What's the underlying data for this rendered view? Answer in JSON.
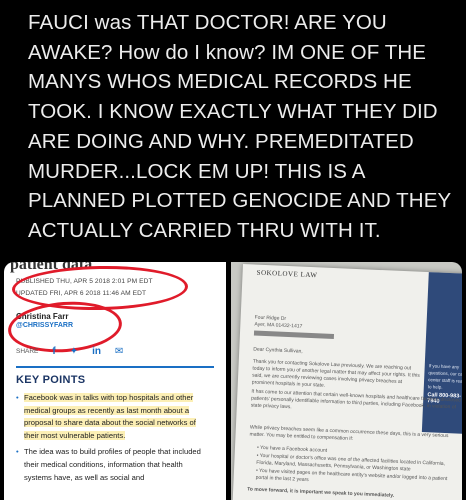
{
  "post": {
    "text": "FAUCI was THAT DOCTOR! ARE YOU AWAKE? How do I know? IM ONE OF THE MANYS WHOS MEDICAL RECORDS HE TOOK. I KNOW EXACTLY WHAT THEY DID ARE DOING AND WHY. PREMEDITATED MURDER...LOCK EM UP! THIS IS A PLANNED PLOTTED GENOCIDE AND THEY ACTUALLY CARRIED THRU WITH IT."
  },
  "article": {
    "heading_fragment": "patient data",
    "published": "PUBLISHED THU, APR 5 2018 2:01 PM EDT",
    "updated": "UPDATED FRI, APR 6 2018 11:46 AM EDT",
    "author": "Christina Farr",
    "handle": "@CHRISSYFARR",
    "share_label": "SHARE",
    "key_points_title": "KEY POINTS",
    "points": [
      "Facebook was in talks with top hospitals and other medical groups as recently as last month about a proposal to share data about the social networks of their most vulnerable patients.",
      "The idea was to build profiles of people that included their medical conditions, information that health systems have, as well as social and"
    ],
    "annotation_color": "#e01b2a",
    "highlight_color": "#fae278"
  },
  "letter": {
    "firm": "SOKOLOVE LAW",
    "address": "Four Ridge Dr\nAyer, MA 01432-1417",
    "greeting": "Dear Cynthia Sullivan,",
    "para1": "Thank you for contacting Sokolove Law previously. We are reaching out today to inform you of another legal matter that may affect your rights. It this said, we are currently reviewing cases involving privacy breaches at prominent hospitals in your state.",
    "para2": "It has come to our attention that certain well-known hospitals and healthcare facilities disclosed patients' personally identifiable information to third parties, including Facebook, in violation of state privacy laws.",
    "para3": "While privacy breaches seem like a common occurrence these days, this is a very serious matter. You may be entitled to compensation if:",
    "bullets": [
      "You have a Facebook account",
      "Your hospital or doctor's office was one of the affected facilities located in California, Florida, Maryland, Massachusetts, Pennsylvania, or Washington state",
      "You have visited pages on the healthcare entity's website and/or logged into a patient portal in the last 2 years"
    ],
    "closing": "To move forward, it is important we speak to you immediately.",
    "sidebar_text": "If you have any questions, our call center staff is ready to help.",
    "phone": "Call 800-983-7940",
    "panel_color": "#2f4a7a"
  }
}
